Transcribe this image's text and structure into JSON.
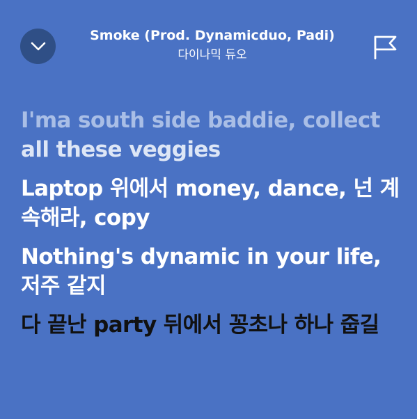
{
  "header": {
    "song_title": "Smoke (Prod. Dynamicduo, Padi)",
    "artist": "다이나믹 듀오",
    "collapse_icon": "chevron-down-icon",
    "report_icon": "flag-icon"
  },
  "lyrics": {
    "line1_sung": "I'ma south side baddie, collect",
    "line1_upcoming": "all these veggies",
    "line2": "Laptop 위에서 money, dance, 넌 계속해라, copy",
    "line3": "Nothing's dynamic in your life, 저주 같지",
    "line4": "다 끝난 party 뒤에서 꽁초나 하나 줍길"
  },
  "colors": {
    "background": "#4a72c4",
    "button_bg": "#2f4f86",
    "sung_text": "#a9bee6",
    "active_text": "#ffffff",
    "next_text": "#111111"
  }
}
